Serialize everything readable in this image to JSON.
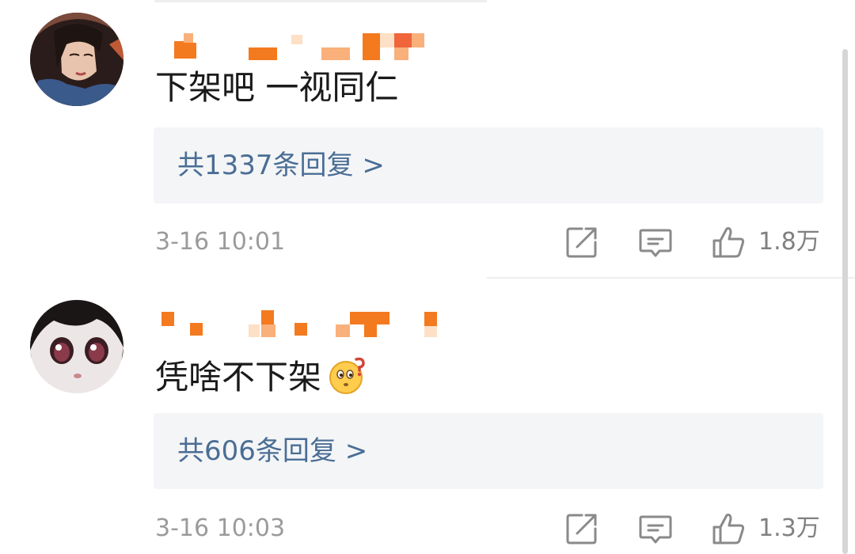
{
  "comments": [
    {
      "avatar": "drawn-female-avatar",
      "text": "下架吧 一视同仁",
      "reply_link": "共1337条回复 >",
      "timestamp": "3-16 10:01",
      "like_count": "1.8万"
    },
    {
      "avatar": "anime-face-avatar",
      "text": "凭啥不下架",
      "emoji": "thinking-emoji",
      "reply_link": "共606条回复 >",
      "timestamp": "3-16 10:03",
      "like_count": "1.3万"
    }
  ],
  "icons": {
    "share": "share-icon",
    "comment": "comment-icon",
    "like": "thumbs-up-icon"
  },
  "colors": {
    "reply_link": "#4a6e95",
    "reply_box_bg": "#f4f5f7",
    "meta_text": "#9b9b9b",
    "username_mosaic": [
      "#f47a1f",
      "#f9b07a",
      "#fde0c6",
      "#f0653a"
    ]
  }
}
